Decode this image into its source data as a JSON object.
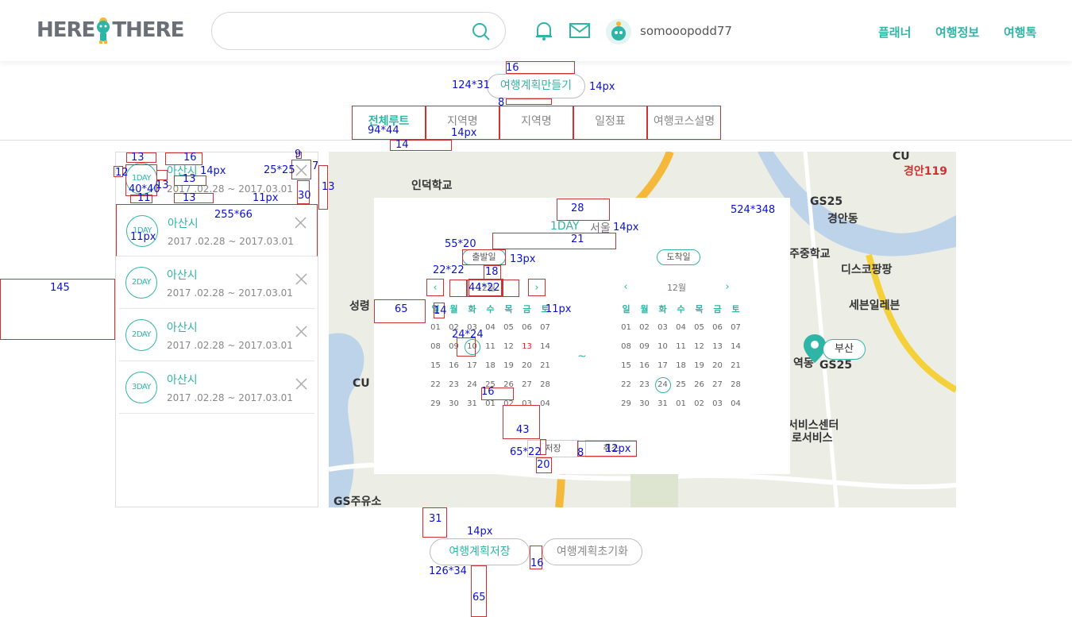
{
  "header": {
    "logo_left": "HERE",
    "logo_right": "THERE",
    "search": {
      "placeholder": ""
    },
    "username": "somooopodd77",
    "nav": [
      "플래너",
      "여행정보",
      "여행톡"
    ]
  },
  "icons": {
    "search": "search-icon",
    "bell": "bell-icon",
    "mail": "mail-icon",
    "avatar": "avatar-icon",
    "close": "close-icon"
  },
  "colors": {
    "accent": "#2fb5a5",
    "spec": "#cc3333",
    "measure": "#0a10d0"
  },
  "make_plan_label": "여행계획만들기",
  "tabs": [
    "전체루트",
    "지역명",
    "지역명",
    "일정표",
    "여행코스설명"
  ],
  "route_items": [
    {
      "day": "1DAY",
      "city": "아산시",
      "dates": "2017 .02.28  ~  2017.03.01"
    },
    {
      "day": "1DAY",
      "city": "아산시",
      "dates": "2017 .02.28  ~  2017.03.01"
    },
    {
      "day": "2DAY",
      "city": "아산시",
      "dates": "2017 .02.28  ~  2017.03.01"
    },
    {
      "day": "2DAY",
      "city": "아산시",
      "dates": "2017 .02.28  ~  2017.03.01"
    },
    {
      "day": "3DAY",
      "city": "아산시",
      "dates": "2017 .02.28  ~  2017.03.01"
    }
  ],
  "map": {
    "labels": [
      "인덕학교",
      "GS25",
      "경안동",
      "주중학교",
      "디스코팡팡",
      "세븐일레븐",
      "성령",
      "CU",
      "CU",
      "GS주유소",
      "서비스센터",
      "로서비스",
      "경안119",
      "역동",
      "GS25"
    ],
    "marker_label": "부산"
  },
  "modal": {
    "day": "1DAY",
    "city": "서울",
    "depart_label": "출발일",
    "arrive_label": "도착일",
    "left_month": "12월",
    "right_month": "12월",
    "weekdays": [
      "일",
      "월",
      "화",
      "수",
      "목",
      "금",
      "토"
    ],
    "days": [
      "01",
      "02",
      "03",
      "04",
      "05",
      "06",
      "07",
      "08",
      "09",
      "10",
      "11",
      "12",
      "13",
      "14",
      "15",
      "16",
      "17",
      "18",
      "19",
      "20",
      "21",
      "22",
      "23",
      "24",
      "25",
      "26",
      "27",
      "28",
      "29",
      "30",
      "31",
      "01",
      "02",
      "03",
      "04"
    ],
    "left_selected": "10",
    "left_red": "13",
    "right_selected": "24",
    "tilde": "~",
    "save_label": "저장",
    "cancel_label": "취소"
  },
  "bottom": {
    "save_plan": "여행계획저장",
    "reset_plan": "여행계획초기화"
  },
  "annotations": [
    "16",
    "124*31",
    "14px",
    "8",
    "94*44",
    "14px",
    "14",
    "13",
    "16",
    "14px",
    "25*25",
    "9",
    "7",
    "12",
    "40*40",
    "13",
    "13",
    "13",
    "11",
    "13",
    "11px",
    "30",
    "255*66",
    "11px",
    "145",
    "28",
    "524*348",
    "1DAY",
    "14px",
    "21",
    "55*20",
    "13px",
    "22*22",
    "18",
    "44*22",
    "65",
    "14",
    "11px",
    "24*24",
    "16",
    "43",
    "65*22",
    "8",
    "12px",
    "20",
    "31",
    "14px",
    "126*34",
    "16",
    "65"
  ]
}
